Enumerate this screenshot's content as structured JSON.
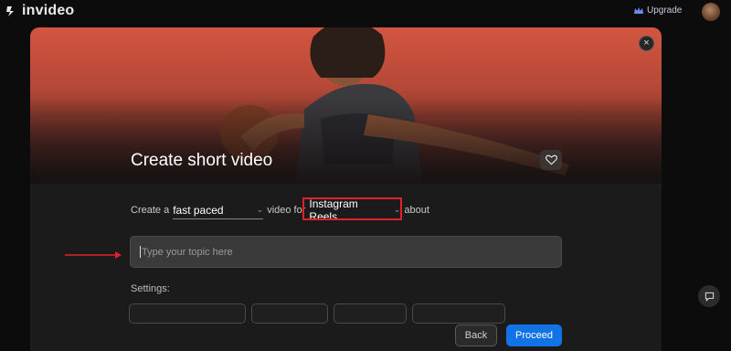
{
  "app": {
    "name": "invideo",
    "upgrade_label": "Upgrade"
  },
  "modal": {
    "title": "Create short video",
    "close_icon": "×",
    "sentence": {
      "prefix": "Create a",
      "pace_value": "fast paced",
      "middle": "video for",
      "platform_value": "Instagram Reels",
      "suffix": "about"
    },
    "topic": {
      "placeholder": "Type your topic here",
      "value": ""
    },
    "settings_label": "Settings:",
    "buttons": {
      "back": "Back",
      "proceed": "Proceed"
    }
  },
  "colors": {
    "accent": "#1173e6",
    "highlight": "#e0212a",
    "hero_top": "#d35541",
    "background": "#0c0c0c"
  },
  "icons": [
    "invideo-logo-icon",
    "crown-icon",
    "avatar",
    "close-icon",
    "heart-icon",
    "chevron-down-icon",
    "chat-icon",
    "arrow-icon"
  ]
}
